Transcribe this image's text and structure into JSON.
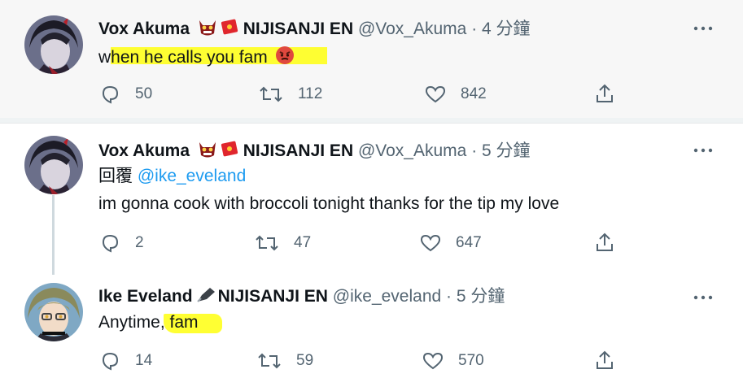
{
  "tweets": [
    {
      "name": "Vox Akuma",
      "badge": "NIJISANJI EN",
      "handle": "@Vox_Akuma",
      "time": "· 4 分鐘",
      "text": "when he calls you fam",
      "replies": "50",
      "retweets": "112",
      "likes": "842"
    },
    {
      "name": "Vox Akuma",
      "badge": "NIJISANJI EN",
      "handle": "@Vox_Akuma",
      "time": "· 5 分鐘",
      "reply_prefix": "回覆",
      "reply_to": "@ike_eveland",
      "text": "im gonna cook with broccoli tonight thanks for the tip my love",
      "replies": "2",
      "retweets": "47",
      "likes": "647"
    },
    {
      "name": "Ike Eveland",
      "badge": "NIJISANJI EN",
      "handle": "@ike_eveland",
      "time": "· 5 分鐘",
      "text": "Anytime, fam",
      "replies": "14",
      "retweets": "59",
      "likes": "570"
    }
  ],
  "icons": {
    "reply": "reply-icon",
    "retweet": "retweet-icon",
    "like": "heart-icon",
    "share": "share-icon",
    "more": "more-icon"
  },
  "colors": {
    "handle": "#536471",
    "mention": "#1d9bf0",
    "highlight": "#ffff00",
    "focused_bg": "#f7f7f7"
  }
}
